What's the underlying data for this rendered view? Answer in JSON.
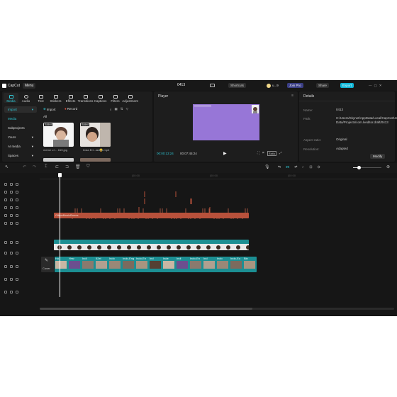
{
  "topbar": {
    "app_name": "CapCut",
    "menu_label": "Menu",
    "project_title": "0413",
    "shortcuts_label": "Shortcuts",
    "user_label": "u...9",
    "join_pro_label": "Join Pro",
    "share_label": "Share",
    "export_label": "Export"
  },
  "media_tabs": [
    {
      "label": "Media",
      "icon": "media-icon",
      "active": true
    },
    {
      "label": "Audio",
      "icon": "audio-icon"
    },
    {
      "label": "Text",
      "icon": "text-icon"
    },
    {
      "label": "Stickers",
      "icon": "sticker-icon"
    },
    {
      "label": "Effects",
      "icon": "effects-icon"
    },
    {
      "label": "Transitions",
      "icon": "transitions-icon"
    },
    {
      "label": "Captions",
      "icon": "captions-icon"
    },
    {
      "label": "Filters",
      "icon": "filters-icon"
    },
    {
      "label": "Adjustment",
      "icon": "adjustment-icon"
    }
  ],
  "media_side": {
    "import_label": "Import",
    "items": [
      "Media",
      "Subprojects",
      "Yours",
      "AI media",
      "Spaces"
    ]
  },
  "media_toolbar": {
    "import_btn": "Import",
    "record_btn": "Record",
    "all_label": "All"
  },
  "media_items": [
    {
      "badge": "Added",
      "caption": "meme u l... 615.jpg"
    },
    {
      "badge": "Added",
      "caption": "Insta Erl...ian😂.mp4"
    }
  ],
  "player": {
    "title": "Player",
    "current_time": "00:00:13:24",
    "total_time": "00:07:45:24",
    "ratio_label": "Ratio"
  },
  "details": {
    "title": "Details",
    "rows": [
      {
        "label": "Name:",
        "value": "0413"
      },
      {
        "label": "Path:",
        "value": "C:/Users/Skynet/AppData/Local/CapCut/User Data/Projects/com.lveditor.draft/0413"
      },
      {
        "label": "Aspect ratio:",
        "value": "Original"
      },
      {
        "label": "Resolution:",
        "value": "Adapted"
      }
    ],
    "modify_label": "Modify"
  },
  "timeline": {
    "ruler": [
      "|00:00",
      "|00:00",
      "|00:00"
    ],
    "audio_track_label": "GibonMusicBones",
    "image_track_label": "meme u laser with 615.jpg  00:07:26:28",
    "cover_label": "Cover",
    "video_clip_labels": [
      "Ho",
      "Yesr",
      "Indi",
      "52el",
      "Indo",
      "Indo-Eng",
      "Indo-En",
      "Ind",
      "Inde",
      "Indi",
      "Indo-En",
      "Ind",
      "Indo",
      "Indo-Eo",
      "Bin"
    ]
  },
  "colors": {
    "accent": "#2ec5d3",
    "export": "#10b7d8",
    "audio_clip": "#b8513b",
    "video_track": "#1c8f93",
    "canvas": "#9776d7",
    "playhead": "#ffffff"
  }
}
